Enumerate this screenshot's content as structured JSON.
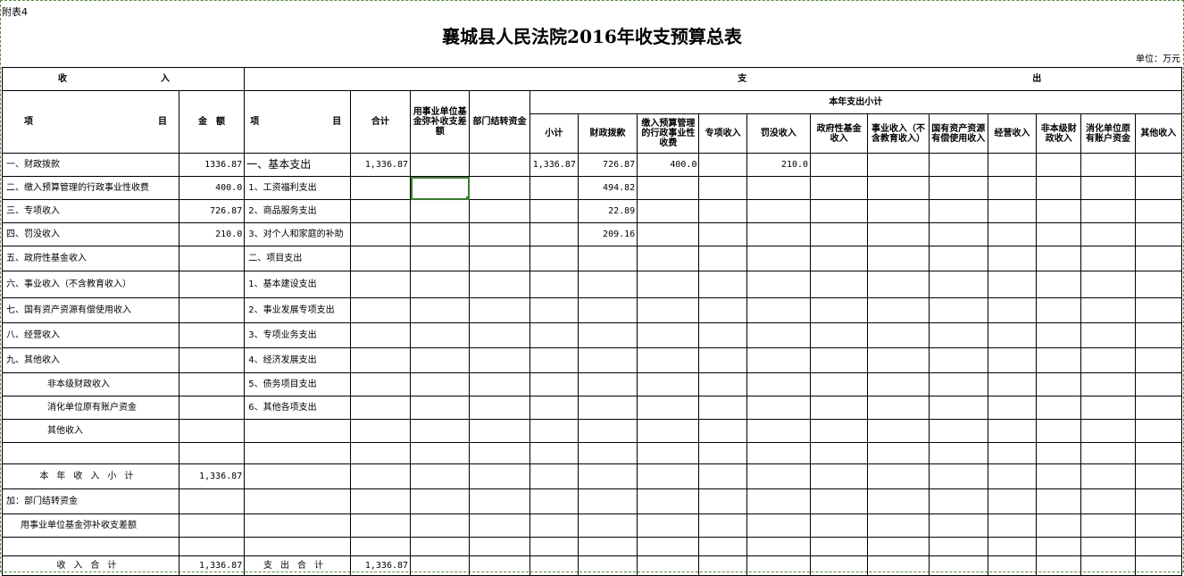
{
  "attachment_label": "附表4",
  "title": "襄城县人民法院2016年收支预算总表",
  "unit": "单位：万元",
  "headers": {
    "income_group": "收",
    "income_group_2": "入",
    "expense_group": "支",
    "expense_group_2": "出",
    "subtotal_group": "本年支出小计",
    "item_left": "项",
    "item_right": "目",
    "amount": "金　额",
    "exp_item_left": "项",
    "exp_item_right": "目",
    "total": "合计",
    "fund_gap": "用事业单位基金弥补收支差额",
    "carryover": "部门结转资金",
    "subtotal": "小计",
    "fiscal": "财政拨款",
    "admin_fees": "缴入预算管理的行政事业性收费",
    "special": "专项收入",
    "confiscation": "罚没收入",
    "gov_fund": "政府性基金收入",
    "business": "事业收入（不含教育收入）",
    "state_assets": "国有资产资源有偿使用收入",
    "operating": "经营收入",
    "non_level_fiscal": "非本级财政收入",
    "digest_account": "消化单位原有账户资金",
    "other": "其他收入"
  },
  "rows": [
    {
      "income_item": "一、财政拨款",
      "income_amount": "1336.87",
      "expense_item": "一、基本支出",
      "total": "1,336.87",
      "fund_gap": "",
      "carryover": "",
      "subtotal": "1,336.87",
      "fiscal": "726.87",
      "admin_fees": "400.0",
      "special": "",
      "confiscation": "210.0"
    },
    {
      "income_item": "二、缴入预算管理的行政事业性收费",
      "income_amount": "400.0",
      "expense_item": "1、工资福利支出",
      "total": "",
      "fund_gap": "",
      "carryover": "",
      "subtotal": "",
      "fiscal": "494.82",
      "admin_fees": "",
      "special": "",
      "confiscation": ""
    },
    {
      "income_item": "三、专项收入",
      "income_amount": "726.87",
      "expense_item": "2、商品服务支出",
      "total": "",
      "fund_gap": "",
      "carryover": "",
      "subtotal": "",
      "fiscal": "22.89",
      "admin_fees": "",
      "special": "",
      "confiscation": ""
    },
    {
      "income_item": "四、罚没收入",
      "income_amount": "210.0",
      "expense_item": "3、对个人和家庭的补助",
      "total": "",
      "fund_gap": "",
      "carryover": "",
      "subtotal": "",
      "fiscal": "209.16",
      "admin_fees": "",
      "special": "",
      "confiscation": ""
    },
    {
      "income_item": "五、政府性基金收入",
      "income_amount": "",
      "expense_item": "二、项目支出",
      "total": "",
      "fund_gap": "",
      "carryover": "",
      "subtotal": "",
      "fiscal": "",
      "admin_fees": "",
      "special": "",
      "confiscation": ""
    },
    {
      "income_item": "六、事业收入（不含教育收入）",
      "income_amount": "",
      "expense_item": "1、基本建设支出",
      "total": "",
      "fund_gap": "",
      "carryover": "",
      "subtotal": "",
      "fiscal": "",
      "admin_fees": "",
      "special": "",
      "confiscation": ""
    },
    {
      "income_item": "七、国有资产资源有偿使用收入",
      "income_amount": "",
      "expense_item": "2、事业发展专项支出",
      "total": "",
      "fund_gap": "",
      "carryover": "",
      "subtotal": "",
      "fiscal": "",
      "admin_fees": "",
      "special": "",
      "confiscation": ""
    },
    {
      "income_item": "八、经营收入",
      "income_amount": "",
      "expense_item": "3、专项业务支出",
      "total": "",
      "fund_gap": "",
      "carryover": "",
      "subtotal": "",
      "fiscal": "",
      "admin_fees": "",
      "special": "",
      "confiscation": ""
    },
    {
      "income_item": "九、其他收入",
      "income_amount": "",
      "expense_item": "4、经济发展支出",
      "total": "",
      "fund_gap": "",
      "carryover": "",
      "subtotal": "",
      "fiscal": "",
      "admin_fees": "",
      "special": "",
      "confiscation": ""
    },
    {
      "income_item": "非本级财政收入",
      "income_amount": "",
      "expense_item": "5、债务项目支出",
      "total": "",
      "fund_gap": "",
      "carryover": "",
      "subtotal": "",
      "fiscal": "",
      "admin_fees": "",
      "special": "",
      "confiscation": ""
    },
    {
      "income_item": "消化单位原有账户资金",
      "income_amount": "",
      "expense_item": "6、其他各项支出",
      "total": "",
      "fund_gap": "",
      "carryover": "",
      "subtotal": "",
      "fiscal": "",
      "admin_fees": "",
      "special": "",
      "confiscation": ""
    },
    {
      "income_item": "其他收入",
      "income_amount": "",
      "expense_item": "",
      "total": "",
      "fund_gap": "",
      "carryover": "",
      "subtotal": "",
      "fiscal": "",
      "admin_fees": "",
      "special": "",
      "confiscation": ""
    }
  ],
  "summary": {
    "year_income_subtotal_label": "本年收入小计",
    "year_income_subtotal_value": "1,336.87",
    "carryover_label": "加：部门结转资金",
    "fund_gap_label": "用事业单位基金弥补收支差额",
    "income_total_label": "收入合计",
    "income_total_value": "1,336.87",
    "expense_total_label": "支出合计",
    "expense_total_value": "1,336.87"
  }
}
